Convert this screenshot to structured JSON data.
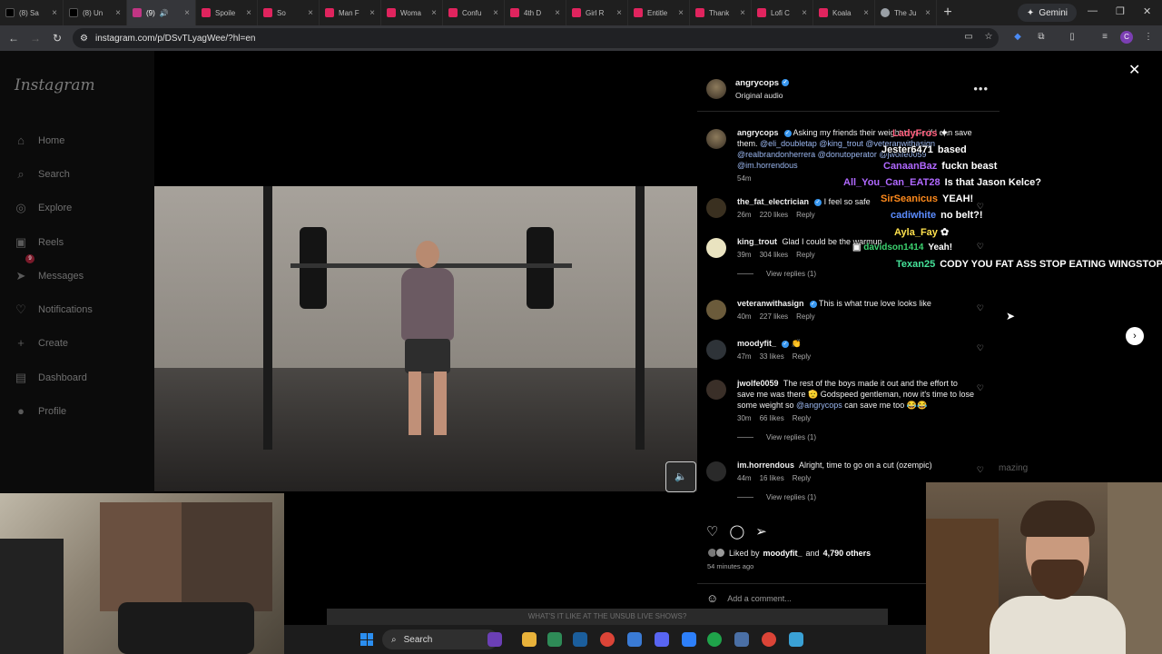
{
  "browser": {
    "tabs": [
      {
        "label": "(8) Sa",
        "color": "#000000"
      },
      {
        "label": "(8) Un",
        "color": "#000000"
      },
      {
        "label": "(9)",
        "color": "#c13584",
        "active": true
      },
      {
        "label": "Spoile",
        "color": "#e0245e"
      },
      {
        "label": "So",
        "color": "#e0245e"
      },
      {
        "label": "Man F",
        "color": "#e0245e"
      },
      {
        "label": "Woma",
        "color": "#e0245e"
      },
      {
        "label": "Confu",
        "color": "#e0245e"
      },
      {
        "label": "4th D",
        "color": "#e0245e"
      },
      {
        "label": "Girl R",
        "color": "#e0245e"
      },
      {
        "label": "Entitle",
        "color": "#e0245e"
      },
      {
        "label": "Thank",
        "color": "#e0245e"
      },
      {
        "label": "Lofi C",
        "color": "#e0245e"
      },
      {
        "label": "Koala",
        "color": "#e0245e"
      },
      {
        "label": "The Ju",
        "color": "#9aa0a6"
      }
    ],
    "new_tab": "+",
    "gemini_label": "Gemini",
    "url": "instagram.com/p/DSvTLyagWee/?hl=en"
  },
  "sidebar": {
    "logo": "Instagram",
    "items": [
      {
        "label": "Home",
        "icon": "⌂"
      },
      {
        "label": "Search",
        "icon": "⌕"
      },
      {
        "label": "Explore",
        "icon": "◎"
      },
      {
        "label": "Reels",
        "icon": "▣"
      },
      {
        "label": "Messages",
        "icon": "➤"
      },
      {
        "label": "Notifications",
        "icon": "♡"
      },
      {
        "label": "Create",
        "icon": "+"
      },
      {
        "label": "Dashboard",
        "icon": "▤"
      },
      {
        "label": "Profile",
        "icon": "●"
      }
    ],
    "messages_badge": "9"
  },
  "post": {
    "author": "angrycops",
    "audio": "Original audio",
    "caption": {
      "user": "angrycops",
      "text": "Asking my friends their weight to see if I can save them.",
      "mentions": "@eli_doubletap @king_trout @veteranwithasign @realbrandonherrera @donutoperator @jwolfe0059 @im.horrendous",
      "time": "54m"
    },
    "comments": [
      {
        "user": "the_fat_electrician",
        "verified": true,
        "text": "I feel so safe",
        "time": "26m",
        "likes": "220 likes",
        "reply": "Reply",
        "replies": ""
      },
      {
        "user": "king_trout",
        "verified": false,
        "text": "Glad I could be the warmup",
        "time": "39m",
        "likes": "304 likes",
        "reply": "Reply",
        "replies": "View replies (1)"
      },
      {
        "user": "veteranwithasign",
        "verified": true,
        "text": "This is what true love looks like",
        "time": "40m",
        "likes": "227 likes",
        "reply": "Reply",
        "replies": ""
      },
      {
        "user": "moodyfit_",
        "verified": true,
        "text": "👏",
        "time": "47m",
        "likes": "33 likes",
        "reply": "Reply",
        "replies": ""
      },
      {
        "user": "jwolfe0059",
        "verified": false,
        "text": "The rest of the boys made it out and the effort to save me was there 🫡 Godspeed gentleman, now it's time to lose some weight so",
        "mention": "@angrycops",
        "tail": "can save me too 😂😂",
        "time": "30m",
        "likes": "66 likes",
        "reply": "Reply",
        "replies": "View replies (1)"
      },
      {
        "user": "im.horrendous",
        "verified": false,
        "text": "Alright, time to go on a cut (ozempic)",
        "time": "44m",
        "likes": "16 likes",
        "reply": "Reply",
        "replies": "View replies (1)"
      }
    ],
    "liked_by_prefix": "Liked by",
    "liked_by_user": "moodyfit_",
    "liked_by_and": "and",
    "liked_by_others": "4,790 others",
    "posted_ago": "54 minutes ago",
    "add_comment_placeholder": "Add a comment..."
  },
  "chat": [
    {
      "name": "LadyFros",
      "color": "#ff5f7e",
      "msg": ""
    },
    {
      "name": "Jester6471",
      "color": "#ffffff",
      "msg": "based"
    },
    {
      "name": "CanaanBaz",
      "color": "#b068ff",
      "msg": "fuckn beast"
    },
    {
      "name": "All_You_Can_EAT28",
      "color": "#b068ff",
      "msg": "Is that Jason Kelce?"
    },
    {
      "name": "SirSeanicus",
      "color": "#ff8a1c",
      "msg": "YEAH!"
    },
    {
      "name": "cadiwhite",
      "color": "#5b8cff",
      "msg": "no belt?!"
    },
    {
      "name": "Ayla_Fay",
      "color": "#ffe14d",
      "msg": ""
    },
    {
      "name": "davidson1414",
      "color": "#3bd16f",
      "msg": "Yeah!"
    },
    {
      "name": "Texan25",
      "color": "#46e39a",
      "msg": "CODY YOU FAT ASS STOP EATING WINGSTOP"
    }
  ],
  "background_text": "mazing",
  "taskbar": {
    "banner": "WHAT'S IT LIKE AT THE UNSUB LIVE SHOWS?",
    "search_label": "Search"
  },
  "colors": {
    "instagram_blue": "#3897f0",
    "verified": "#3897f0"
  }
}
